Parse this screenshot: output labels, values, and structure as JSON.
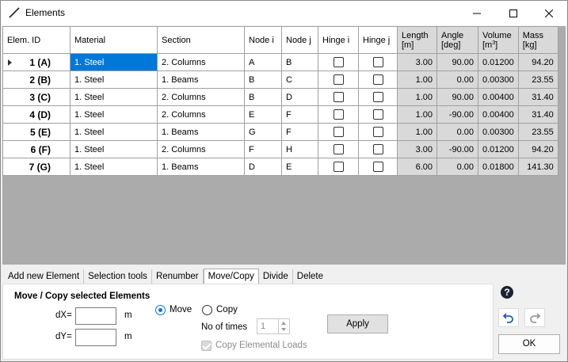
{
  "window": {
    "title": "Elements",
    "icon": "line-element-icon",
    "controls": [
      "minimize-icon",
      "maximize-icon",
      "close-icon"
    ]
  },
  "grid": {
    "headers": {
      "elem_id": "Elem. ID",
      "material": "Material",
      "section": "Section",
      "node_i": "Node i",
      "node_j": "Node j",
      "hinge_i": "Hinge i",
      "hinge_j": "Hinge j",
      "length": "Length",
      "length_unit": "[m]",
      "angle": "Angle",
      "angle_unit": "[deg]",
      "volume": "Volume",
      "volume_unit_pre": "[m",
      "volume_unit_sup": "3",
      "volume_unit_post": "]",
      "mass": "Mass",
      "mass_unit": "[kg]"
    },
    "rows": [
      {
        "id": "1 (A)",
        "material": "1. Steel",
        "section": "2. Columns",
        "node_i": "A",
        "node_j": "B",
        "hinge_i": false,
        "hinge_j": false,
        "length": "3.00",
        "angle": "90.00",
        "volume": "0.01200",
        "mass": "94.20"
      },
      {
        "id": "2 (B)",
        "material": "1. Steel",
        "section": "1. Beams",
        "node_i": "B",
        "node_j": "C",
        "hinge_i": false,
        "hinge_j": false,
        "length": "1.00",
        "angle": "0.00",
        "volume": "0.00300",
        "mass": "23.55"
      },
      {
        "id": "3 (C)",
        "material": "1. Steel",
        "section": "2. Columns",
        "node_i": "B",
        "node_j": "D",
        "hinge_i": false,
        "hinge_j": false,
        "length": "1.00",
        "angle": "90.00",
        "volume": "0.00400",
        "mass": "31.40"
      },
      {
        "id": "4 (D)",
        "material": "1. Steel",
        "section": "2. Columns",
        "node_i": "E",
        "node_j": "F",
        "hinge_i": false,
        "hinge_j": false,
        "length": "1.00",
        "angle": "-90.00",
        "volume": "0.00400",
        "mass": "31.40"
      },
      {
        "id": "5 (E)",
        "material": "1. Steel",
        "section": "1. Beams",
        "node_i": "G",
        "node_j": "F",
        "hinge_i": false,
        "hinge_j": false,
        "length": "1.00",
        "angle": "0.00",
        "volume": "0.00300",
        "mass": "23.55"
      },
      {
        "id": "6 (F)",
        "material": "1. Steel",
        "section": "2. Columns",
        "node_i": "F",
        "node_j": "H",
        "hinge_i": false,
        "hinge_j": false,
        "length": "3.00",
        "angle": "-90.00",
        "volume": "0.01200",
        "mass": "94.20"
      },
      {
        "id": "7 (G)",
        "material": "1. Steel",
        "section": "1. Beams",
        "node_i": "D",
        "node_j": "E",
        "hinge_i": false,
        "hinge_j": false,
        "length": "6.00",
        "angle": "0.00",
        "volume": "0.01800",
        "mass": "141.30"
      }
    ]
  },
  "tabs": [
    "Add new Element",
    "Selection tools",
    "Renumber",
    "Move/Copy",
    "Divide",
    "Delete"
  ],
  "active_tab": "Move/Copy",
  "panel": {
    "title": "Move / Copy selected Elements",
    "dx_label": "dX=",
    "dy_label": "dY=",
    "dx_value": "",
    "dy_value": "",
    "unit": "m",
    "move_label": "Move",
    "copy_label": "Copy",
    "mode": "Move",
    "times_label": "No of times",
    "times_value": "1",
    "copy_loads_label": "Copy Elemental Loads",
    "copy_loads_checked": true,
    "apply_label": "Apply"
  },
  "side": {
    "help_icon": "help-icon",
    "undo_icon": "undo-icon",
    "redo_icon": "redo-icon",
    "ok_label": "OK"
  },
  "colors": {
    "selection": "#0078d7",
    "readonly_cell": "#d9d9d9",
    "grid_background": "#ababab"
  }
}
